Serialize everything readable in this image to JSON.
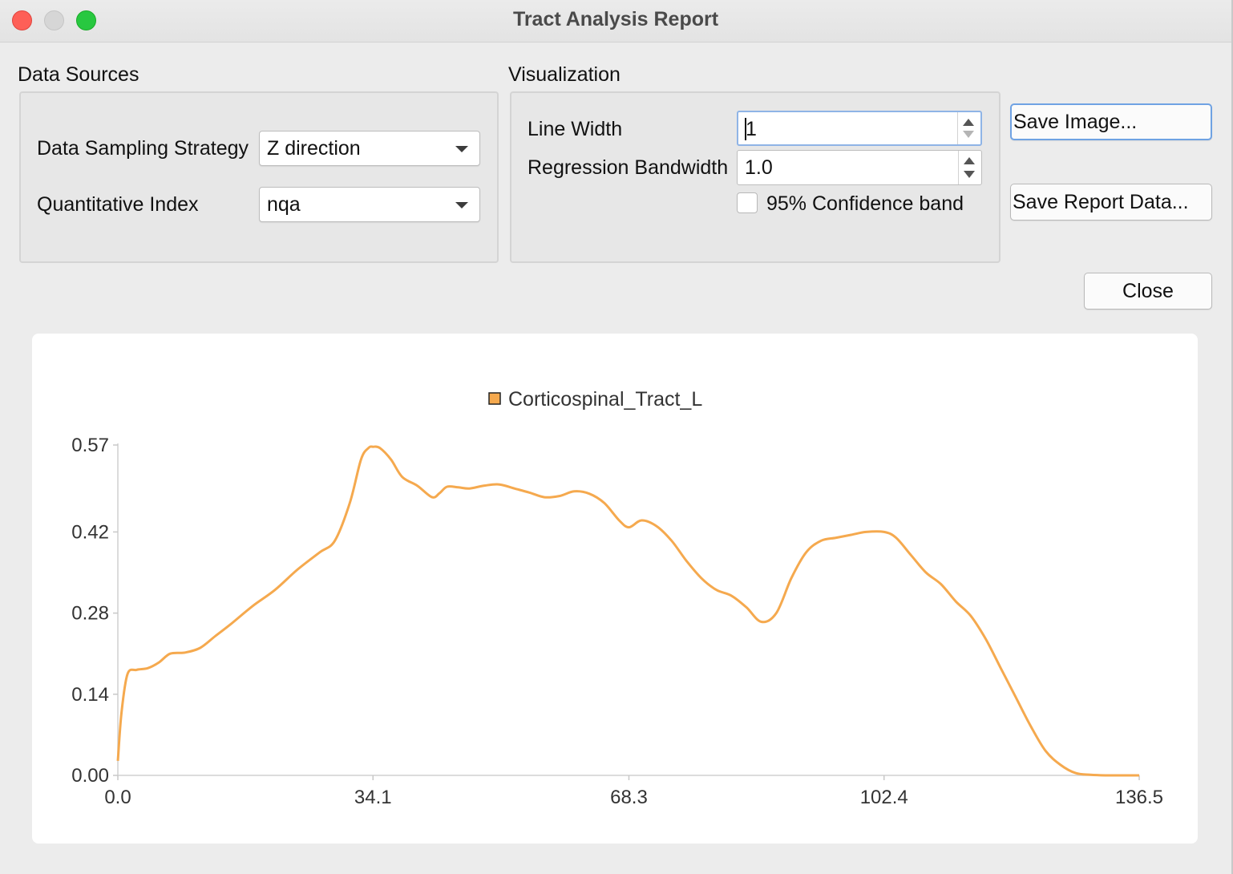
{
  "window": {
    "title": "Tract Analysis Report"
  },
  "data_sources": {
    "title": "Data Sources",
    "sampling_label": "Data Sampling Strategy",
    "sampling_value": "Z direction",
    "index_label": "Quantitative Index",
    "index_value": "nqa"
  },
  "visualization": {
    "title": "Visualization",
    "line_width_label": "Line Width",
    "line_width_value": "1",
    "bandwidth_label": "Regression Bandwidth",
    "bandwidth_value": "1.0",
    "confidence_label": "95% Confidence band",
    "confidence_checked": false
  },
  "buttons": {
    "save_image": "Save Image...",
    "save_report": "Save Report Data...",
    "close": "Close"
  },
  "colors": {
    "series": "#f5a94e",
    "accent_focus": "#6fa2e3"
  },
  "chart_data": {
    "type": "line",
    "legend_position": "top-center",
    "series": [
      {
        "name": "Corticospinal_Tract_L",
        "color": "#f5a94e",
        "x": [
          0.0,
          0.5,
          1.3,
          2.5,
          4.0,
          5.5,
          7.0,
          9.0,
          11.0,
          13.0,
          15.0,
          18.0,
          21.0,
          24.0,
          27.0,
          29.0,
          31.0,
          32.5,
          33.5,
          34.1,
          35.0,
          36.5,
          38.0,
          40.0,
          42.0,
          43.0,
          44.0,
          45.5,
          47.0,
          49.0,
          51.0,
          53.0,
          55.0,
          57.0,
          59.0,
          61.0,
          63.0,
          65.0,
          67.0,
          68.3,
          70.0,
          72.0,
          74.0,
          76.0,
          78.0,
          80.0,
          82.0,
          84.0,
          86.0,
          88.0,
          90.0,
          92.0,
          94.0,
          96.0,
          98.0,
          100.0,
          102.4,
          104.0,
          106.0,
          108.0,
          110.0,
          112.0,
          114.0,
          116.0,
          118.0,
          120.0,
          122.0,
          124.0,
          126.0,
          128.0,
          130.0,
          132.0,
          134.0,
          136.5
        ],
        "y": [
          0.025,
          0.11,
          0.175,
          0.182,
          0.185,
          0.195,
          0.21,
          0.212,
          0.22,
          0.24,
          0.26,
          0.292,
          0.32,
          0.355,
          0.385,
          0.405,
          0.47,
          0.545,
          0.565,
          0.567,
          0.565,
          0.545,
          0.515,
          0.5,
          0.48,
          0.487,
          0.498,
          0.497,
          0.495,
          0.5,
          0.502,
          0.495,
          0.488,
          0.48,
          0.482,
          0.49,
          0.486,
          0.47,
          0.44,
          0.428,
          0.44,
          0.43,
          0.405,
          0.37,
          0.34,
          0.32,
          0.31,
          0.29,
          0.265,
          0.28,
          0.34,
          0.385,
          0.405,
          0.41,
          0.415,
          0.42,
          0.42,
          0.41,
          0.38,
          0.35,
          0.33,
          0.3,
          0.275,
          0.235,
          0.185,
          0.135,
          0.085,
          0.042,
          0.018,
          0.004,
          0.001,
          0.0,
          0.0,
          0.0
        ]
      }
    ],
    "xticks": [
      "0.0",
      "34.1",
      "68.3",
      "102.4",
      "136.5"
    ],
    "yticks": [
      "0.00",
      "0.14",
      "0.28",
      "0.42",
      "0.57"
    ],
    "xlim": [
      0,
      136.5
    ],
    "ylim": [
      0,
      0.57
    ],
    "grid": false
  }
}
